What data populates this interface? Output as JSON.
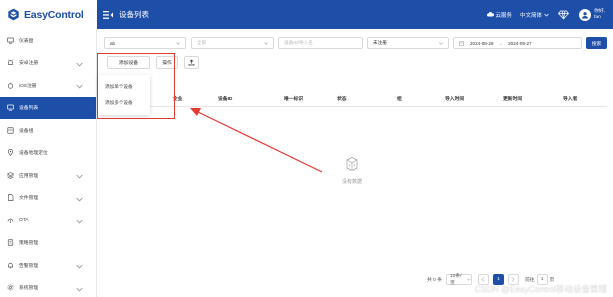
{
  "header": {
    "brand": "EasyControl",
    "page_title": "设备列表",
    "cloud_service": "云服务",
    "language": "中文简体",
    "user_line1": "你好,",
    "user_line2": "fan",
    "accent_color": "#1d4fa8"
  },
  "sidebar": {
    "items": [
      {
        "label": "仪表盘",
        "icon": "dashboard-icon",
        "chevron": false
      },
      {
        "label": "安卓注册",
        "icon": "android-icon",
        "chevron": true
      },
      {
        "label": "iOS注册",
        "icon": "apple-icon",
        "chevron": true
      },
      {
        "label": "设备列表",
        "icon": "device-list-icon",
        "chevron": false,
        "active": true
      },
      {
        "label": "设备组",
        "icon": "device-group-icon",
        "chevron": false
      },
      {
        "label": "设备地理定位",
        "icon": "location-icon",
        "chevron": false
      },
      {
        "label": "应用管理",
        "icon": "app-icon",
        "chevron": true
      },
      {
        "label": "文件管理",
        "icon": "file-icon",
        "chevron": true
      },
      {
        "label": "OTA",
        "icon": "ota-icon",
        "chevron": true
      },
      {
        "label": "策略管理",
        "icon": "policy-icon",
        "chevron": false
      },
      {
        "label": "告警管理",
        "icon": "alarm-icon",
        "chevron": true
      },
      {
        "label": "系统管理",
        "icon": "system-icon",
        "chevron": true
      }
    ]
  },
  "filters": {
    "select1_value": "ab",
    "select2_placeholder": "全部",
    "device_id_placeholder": "设备ID/导入名",
    "register_status_value": "未注册",
    "date_start": "2024-08-28",
    "date_sep": "→",
    "date_end": "2024-09-27",
    "search_label": "搜索"
  },
  "toolbar": {
    "add_device_label": "添加设备",
    "operation_label": "操作"
  },
  "dropdown": {
    "items": [
      "添加单个设备",
      "添加多个设备"
    ]
  },
  "table": {
    "columns": [
      "企业",
      "设备ID",
      "唯一标识",
      "状态",
      "组",
      "导入时间",
      "更新时间",
      "导入者"
    ]
  },
  "empty_state": {
    "label": "没有数据"
  },
  "pagination": {
    "total_text": "共 0 条",
    "page_size": "10条/页",
    "current_page": "1",
    "goto_label": "前往",
    "goto_value": "1",
    "page_label": "页"
  },
  "watermark": "CSDN @EasyControl移动设备管理",
  "annotation_color": "#e53b30"
}
